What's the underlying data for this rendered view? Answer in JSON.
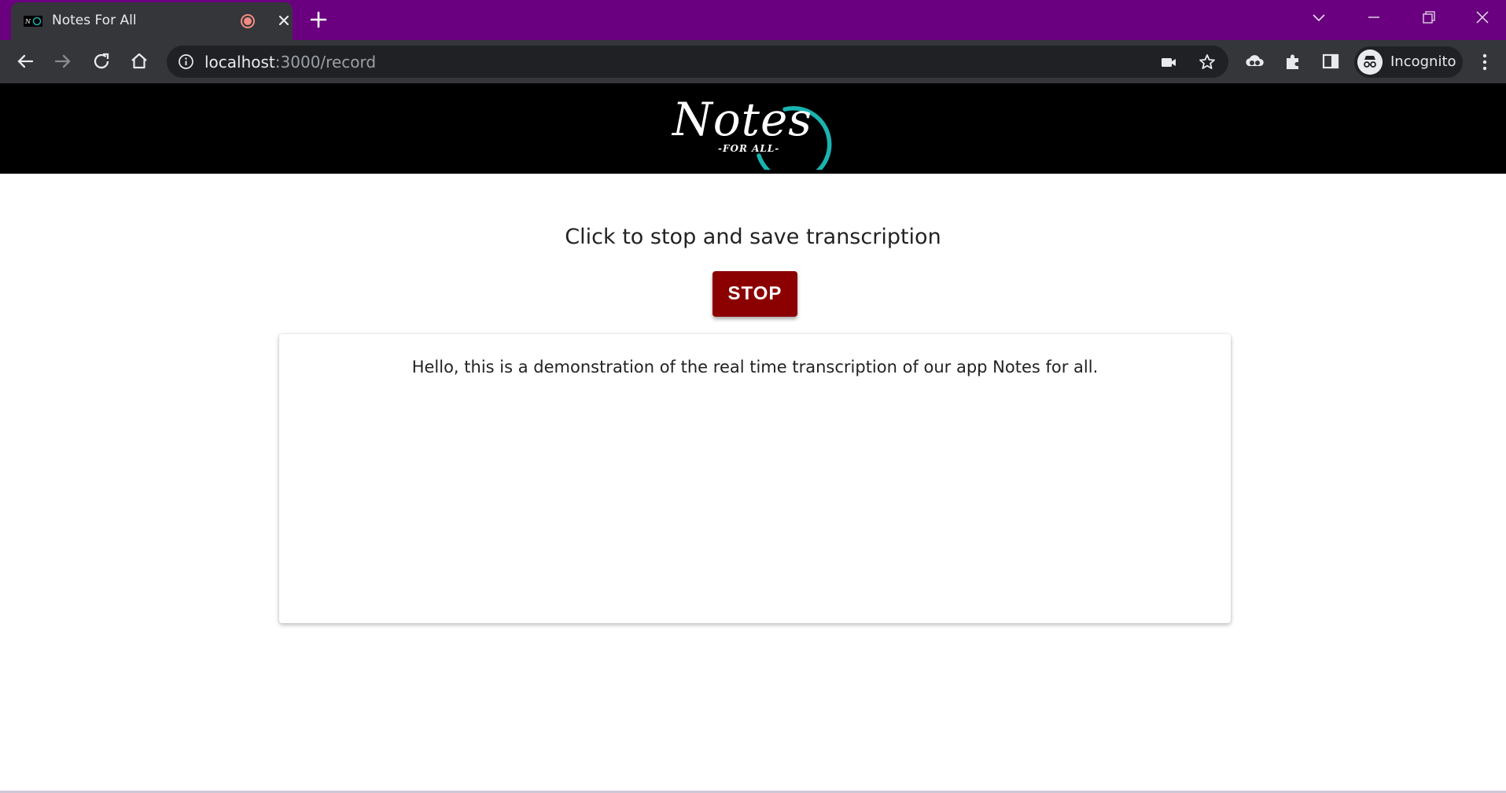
{
  "browser": {
    "tab": {
      "title": "Notes For All"
    },
    "address": {
      "host": "localhost",
      "path": ":3000/record"
    },
    "profile": {
      "label": "Incognito"
    }
  },
  "app": {
    "logo": {
      "main": "Notes",
      "sub": "-FOR ALL-"
    },
    "accent_color": "#1ab3b0",
    "instruction": "Click to stop and save transcription",
    "stop_label": "STOP",
    "stop_color": "#8b0000",
    "transcript": "Hello, this is a demonstration of the real time transcription of our app Notes for all."
  }
}
